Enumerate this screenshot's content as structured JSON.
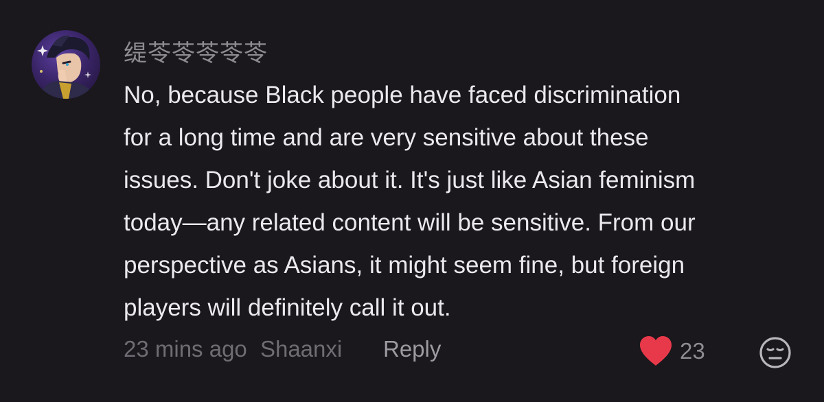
{
  "comment": {
    "username": "缇苓苓苓苓苓",
    "body_lines": [
      "No, because Black people have faced discrimination",
      "for a long time and are very sensitive about these",
      "issues. Don't joke about it. It's just like Asian feminism",
      "today—any related content will be sensitive. From our",
      "perspective as Asians, it might seem fine, but foreign",
      "players will definitely call it out."
    ],
    "time": "23 mins ago",
    "location": "Shaanxi",
    "reply_label": "Reply",
    "like_count": "23",
    "liked": true,
    "like_icon": "heart-icon",
    "dislike_icon": "neutral-face-icon"
  },
  "colors": {
    "background": "#1a181c",
    "text": "#ebe9ed",
    "muted": "#6f6c73",
    "heart": "#e8394a"
  }
}
